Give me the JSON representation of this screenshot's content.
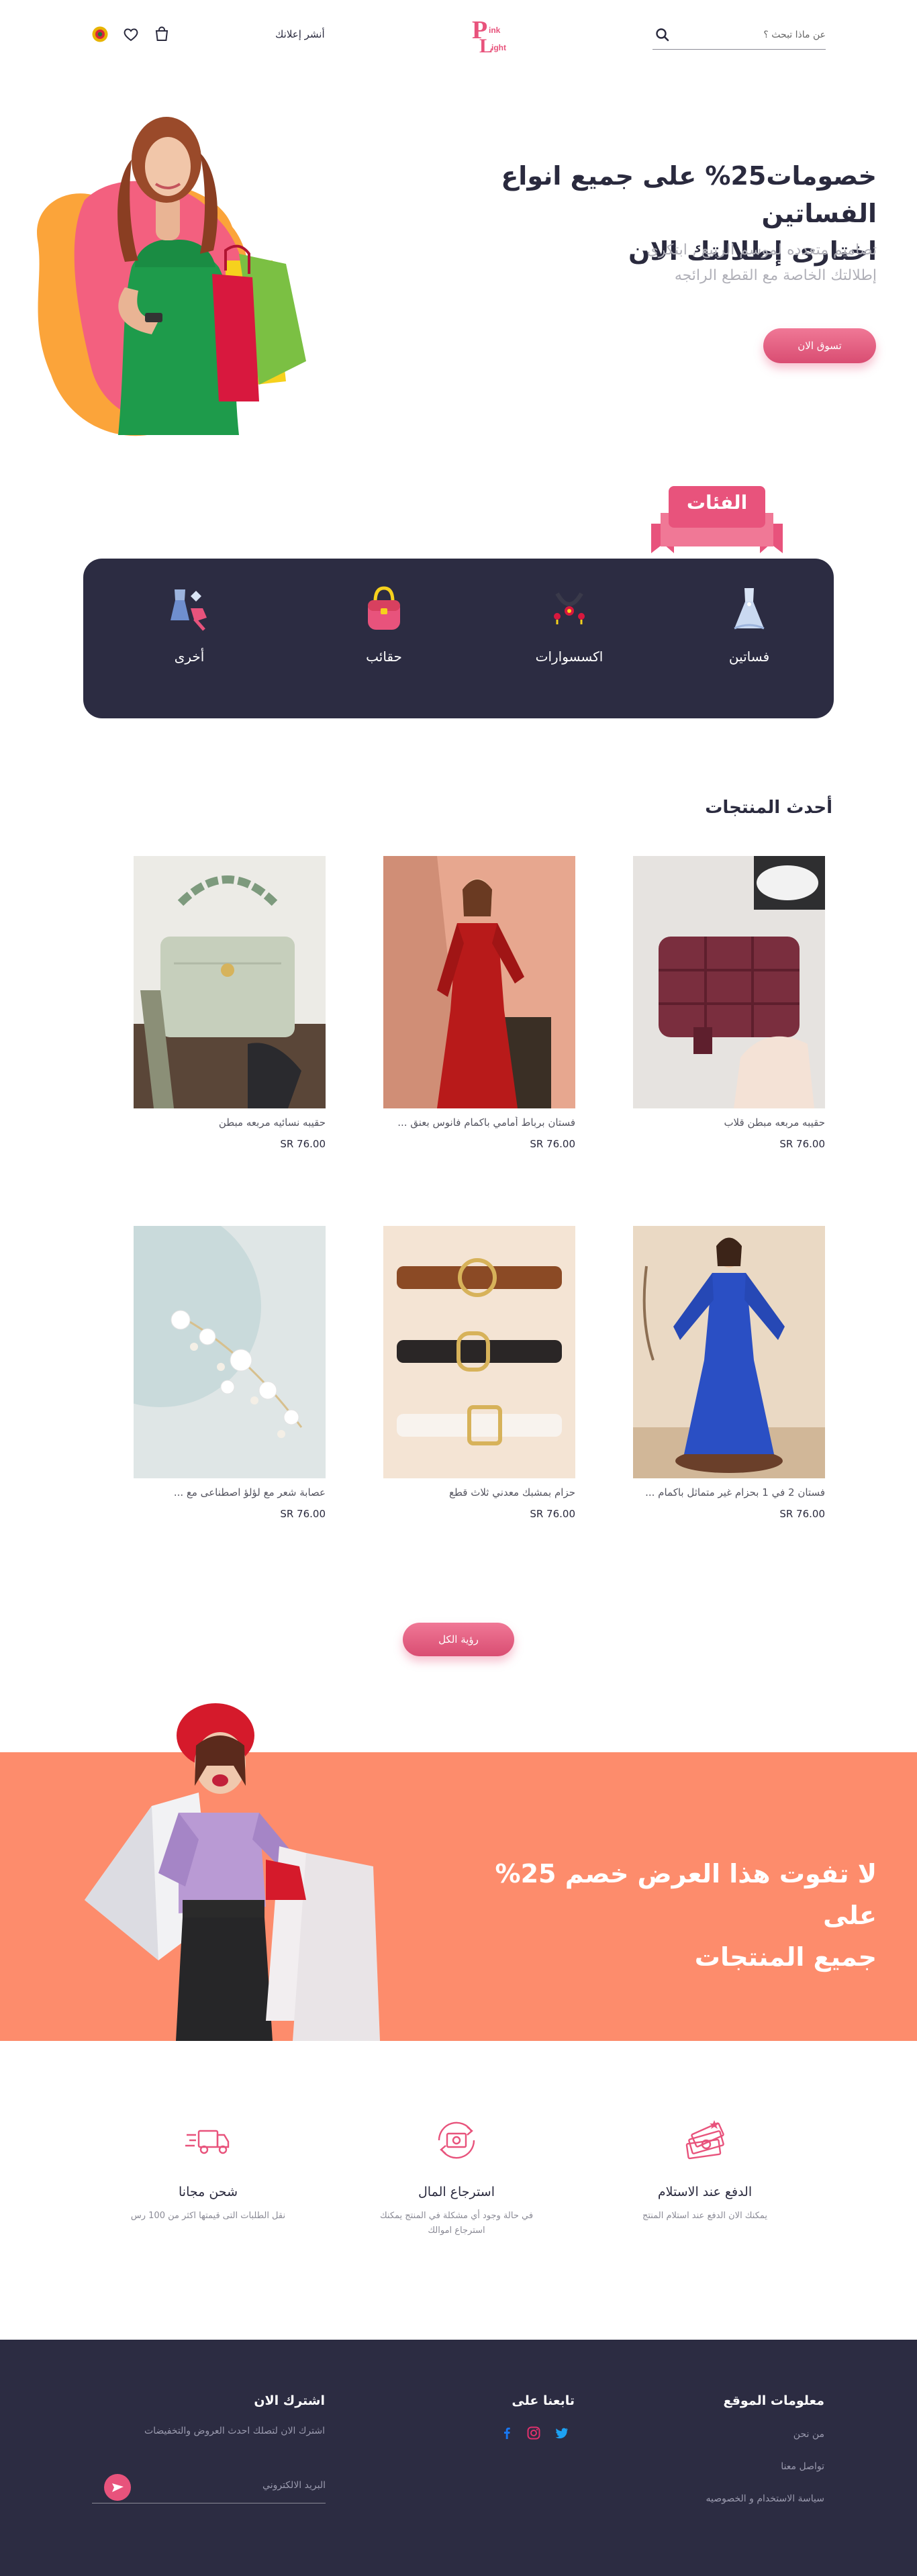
{
  "header": {
    "search_placeholder": "عن ماذا تبحث ؟",
    "brand_line1": "ink",
    "brand_line2": "ight",
    "brand_p": "P",
    "brand_l": "L",
    "signin": "أنشر إعلانك"
  },
  "hero": {
    "title_line1": "خصومات25% على جميع انواع الفساتين",
    "title_line2": "اختارى إطلالتك الان",
    "subtitle_line1": "تصاميم متعدده لموسم الربيع , ابتكرى",
    "subtitle_line2": "إطلالتك الخاصة مع القطع الرائجه",
    "cta": "تسوق الان"
  },
  "categories": {
    "title": "الفئات",
    "items": [
      {
        "label": "فساتين",
        "icon": "dress-icon"
      },
      {
        "label": "اكسسوارات",
        "icon": "accessories-icon"
      },
      {
        "label": "حقائب",
        "icon": "bag-icon"
      },
      {
        "label": "أخرى",
        "icon": "other-icon"
      }
    ]
  },
  "products": {
    "title": "أحدث المنتجات",
    "items": [
      {
        "name": "حقيبه مربعه مبطن قلاب",
        "price": "SR 76.00"
      },
      {
        "name": "فستان برباط أمامي باكمام فانوس بعنق ...",
        "price": "SR 76.00"
      },
      {
        "name": "حقيبه نسائيه مربعه مبطن",
        "price": "SR 76.00"
      },
      {
        "name": "فستان 2 في 1 بحزام غير متماثل باكمام ...",
        "price": "SR 76.00"
      },
      {
        "name": "حزام بمشبك معدني ثلاث قطع",
        "price": "SR 76.00"
      },
      {
        "name": "عصابة شعر مع لؤلؤ اصطناعى مع ...",
        "price": "SR 76.00"
      }
    ],
    "see_all": "رؤية الكل"
  },
  "promo": {
    "line1": "لا تفوت هذا العرض خصم 25% على",
    "line2": "جميع المنتجات"
  },
  "features": [
    {
      "title": "الدفع عند الاستلام",
      "desc_line1": "يمكنك الان الدفع عند استلام المنتج",
      "desc_line2": "",
      "icon": "cash-icon"
    },
    {
      "title": "استرجاع المال",
      "desc_line1": "في حالة وجود أي مشكلة في المنتج يمكنك",
      "desc_line2": "استرجاع اموالك",
      "icon": "refund-icon"
    },
    {
      "title": "شحن مجانا",
      "desc_line1": "نقل الطلبات التى قيمتها اكثر من 100 رس",
      "desc_line2": "",
      "icon": "truck-icon"
    }
  ],
  "footer": {
    "info_title": "معلومات الموقع",
    "info_links": [
      "من نحن",
      "تواصل معنا",
      "سياسة الاستخدام و الخصوصيه"
    ],
    "follow_title": "تابعنا على",
    "subscribe_title": "اشترك الان",
    "subscribe_desc": "اشترك الان لتصلك احدث العروض والتخفيضات",
    "email_placeholder": "البريد الالكتروني"
  },
  "colors": {
    "accent": "#e8537c",
    "dark": "#2c2c42",
    "promo": "#fd8c6c"
  }
}
